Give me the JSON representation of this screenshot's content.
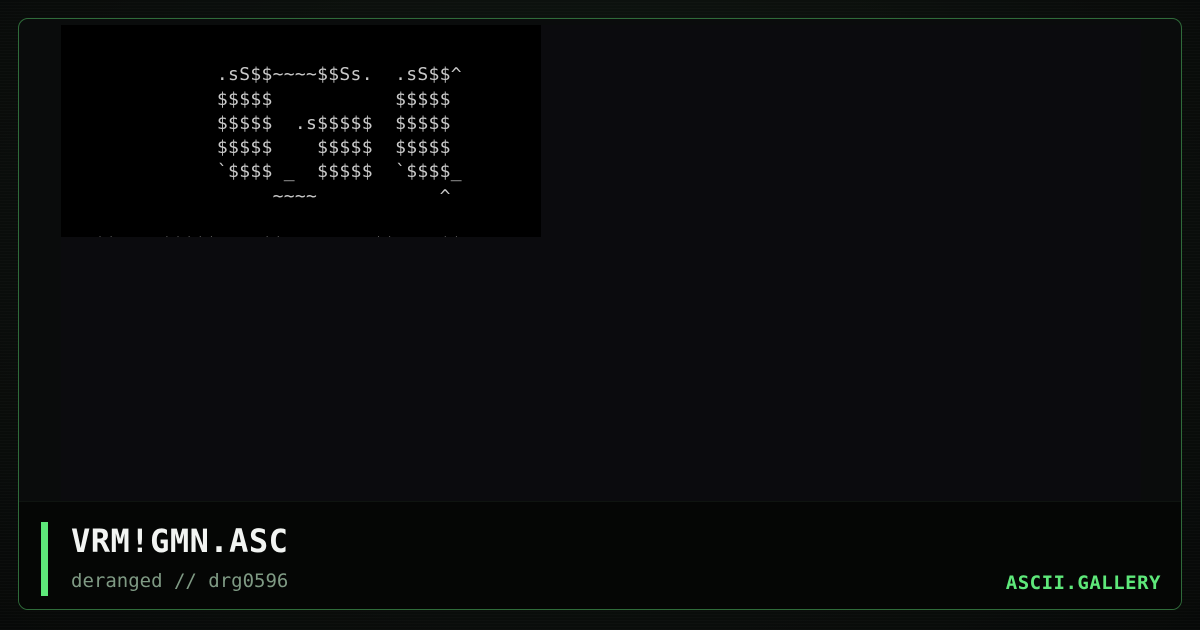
{
  "artwork": {
    "lines": [
      "",
      "              .sS$$~~~~$$Ss.  .sS$$^",
      "              $$$$$           $$$$$",
      "              $$$$$  .s$$$$$  $$$$$",
      "              $$$$$    $$$$$  $$$$$",
      "              `$$$$ _  $$$$$  `$$$$_",
      "                   ~~~~           ^",
      "",
      ".sS$$~~~~$$$$$~~~~$$Ss.  .sS$$~~~~$$Ss."
    ]
  },
  "caption": {
    "title": "VRM!GMN.ASC",
    "subtitle": "deranged // drg0596",
    "brand": "ASCII.GALLERY"
  },
  "colors": {
    "accent": "#5ee87a",
    "frame_border": "#2f6b3a",
    "art_text": "#c9c9c9",
    "title_text": "#f2f4f2",
    "subtitle_text": "#7f9a84"
  }
}
